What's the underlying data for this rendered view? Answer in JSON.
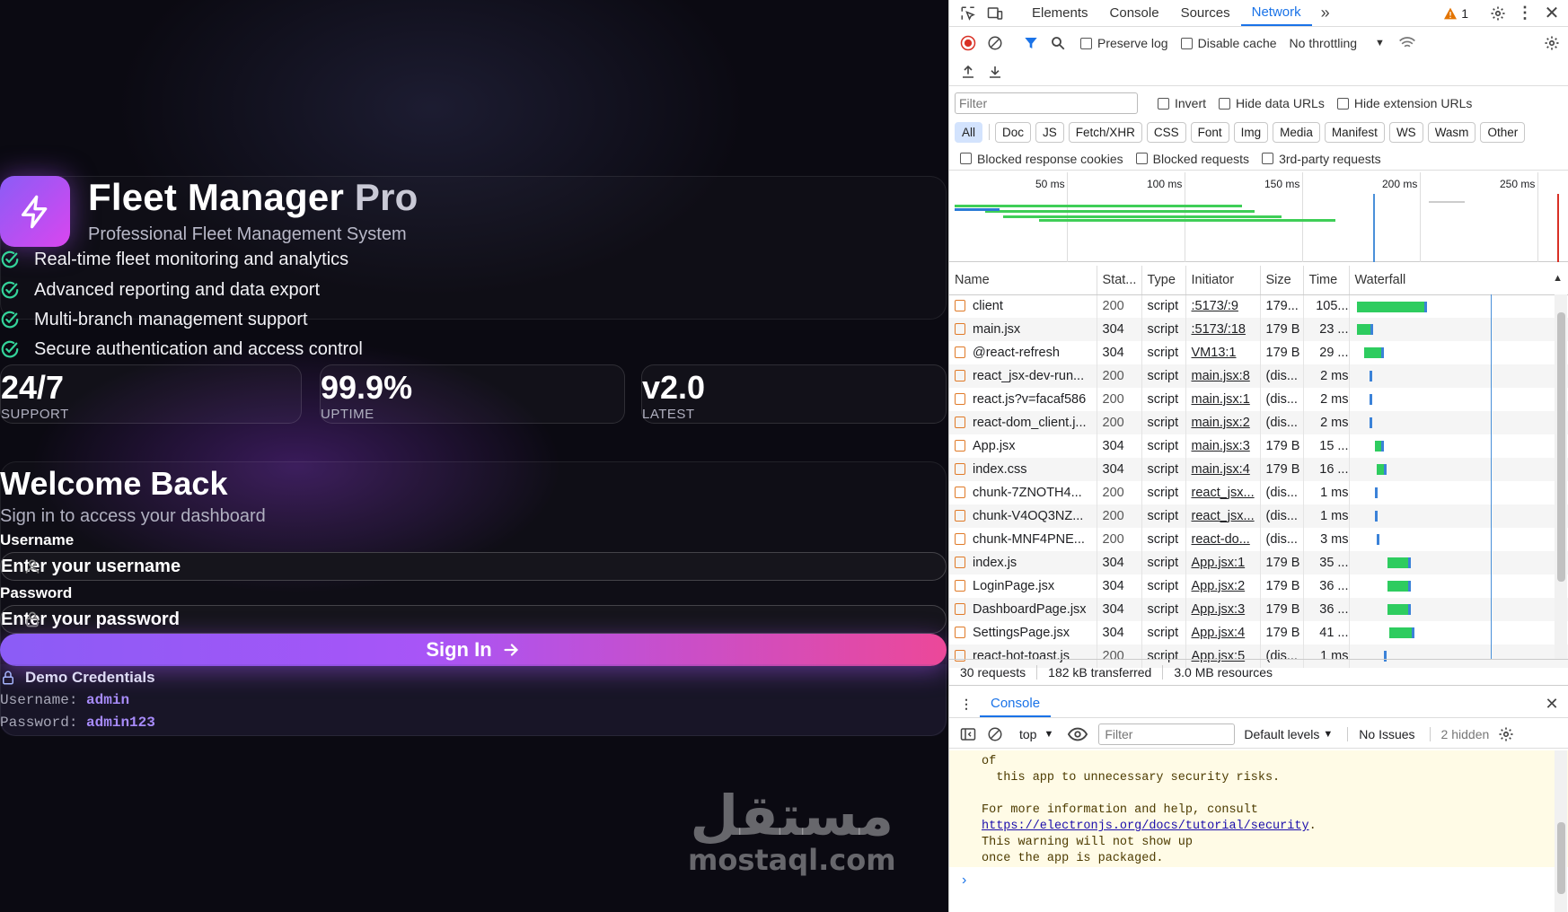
{
  "app": {
    "title": "Fleet Manager",
    "title_suffix": "Pro",
    "subtitle": "Professional Fleet Management System",
    "features": [
      "Real-time fleet monitoring and analytics",
      "Advanced reporting and data export",
      "Multi-branch management support",
      "Secure authentication and access control"
    ],
    "stats": [
      {
        "value": "24/7",
        "label": "SUPPORT"
      },
      {
        "value": "99.9%",
        "label": "UPTIME"
      },
      {
        "value": "v2.0",
        "label": "LATEST"
      }
    ],
    "login": {
      "title": "Welcome Back",
      "subtitle": "Sign in to access your dashboard",
      "username_label": "Username",
      "username_placeholder": "Enter your username",
      "password_label": "Password",
      "password_placeholder": "Enter your password",
      "submit_label": "Sign In"
    },
    "demo": {
      "title": "Demo Credentials",
      "username_key": "Username:",
      "username": "admin",
      "password_key": "Password:",
      "password": "admin123"
    },
    "watermark": {
      "arabic": "مستقل",
      "latin": "mostaql.com"
    },
    "accent": "#a855f7",
    "success": "#22c55e"
  },
  "devtools": {
    "tabs": [
      "Elements",
      "Console",
      "Sources",
      "Network"
    ],
    "active_tab": "Network",
    "warning_count": "1",
    "toolbar": {
      "preserve_log": "Preserve log",
      "disable_cache": "Disable cache",
      "throttling": "No throttling"
    },
    "filter": {
      "placeholder": "Filter",
      "invert": "Invert",
      "hide_data": "Hide data URLs",
      "hide_ext": "Hide extension URLs"
    },
    "chips": [
      "All",
      "Doc",
      "JS",
      "Fetch/XHR",
      "CSS",
      "Font",
      "Img",
      "Media",
      "Manifest",
      "WS",
      "Wasm",
      "Other"
    ],
    "blocked": {
      "cookies": "Blocked response cookies",
      "requests": "Blocked requests",
      "third": "3rd-party requests"
    },
    "timeline_ticks": [
      "50 ms",
      "100 ms",
      "150 ms",
      "200 ms",
      "250 ms"
    ],
    "columns": [
      "Name",
      "Stat...",
      "Type",
      "Initiator",
      "Size",
      "Time",
      "Waterfall"
    ],
    "requests": [
      {
        "name": "client",
        "status": "200",
        "type": "script",
        "initiator": ":5173/:9",
        "size": "179...",
        "time": "105..."
      },
      {
        "name": "main.jsx",
        "status": "304",
        "type": "script",
        "initiator": ":5173/:18",
        "size": "179 B",
        "time": "23 ..."
      },
      {
        "name": "@react-refresh",
        "status": "304",
        "type": "script",
        "initiator": "VM13:1",
        "size": "179 B",
        "time": "29 ..."
      },
      {
        "name": "react_jsx-dev-run...",
        "status": "200",
        "type": "script",
        "initiator": "main.jsx:8",
        "size": "(dis...",
        "time": "2 ms"
      },
      {
        "name": "react.js?v=facaf586",
        "status": "200",
        "type": "script",
        "initiator": "main.jsx:1",
        "size": "(dis...",
        "time": "2 ms"
      },
      {
        "name": "react-dom_client.j...",
        "status": "200",
        "type": "script",
        "initiator": "main.jsx:2",
        "size": "(dis...",
        "time": "2 ms"
      },
      {
        "name": "App.jsx",
        "status": "304",
        "type": "script",
        "initiator": "main.jsx:3",
        "size": "179 B",
        "time": "15 ..."
      },
      {
        "name": "index.css",
        "status": "304",
        "type": "script",
        "initiator": "main.jsx:4",
        "size": "179 B",
        "time": "16 ..."
      },
      {
        "name": "chunk-7ZNOTH4...",
        "status": "200",
        "type": "script",
        "initiator": "react_jsx...",
        "size": "(dis...",
        "time": "1 ms"
      },
      {
        "name": "chunk-V4OQ3NZ...",
        "status": "200",
        "type": "script",
        "initiator": "react_jsx...",
        "size": "(dis...",
        "time": "1 ms"
      },
      {
        "name": "chunk-MNF4PNE...",
        "status": "200",
        "type": "script",
        "initiator": "react-do...",
        "size": "(dis...",
        "time": "3 ms"
      },
      {
        "name": "index.js",
        "status": "304",
        "type": "script",
        "initiator": "App.jsx:1",
        "size": "179 B",
        "time": "35 ..."
      },
      {
        "name": "LoginPage.jsx",
        "status": "304",
        "type": "script",
        "initiator": "App.jsx:2",
        "size": "179 B",
        "time": "36 ..."
      },
      {
        "name": "DashboardPage.jsx",
        "status": "304",
        "type": "script",
        "initiator": "App.jsx:3",
        "size": "179 B",
        "time": "36 ..."
      },
      {
        "name": "SettingsPage.jsx",
        "status": "304",
        "type": "script",
        "initiator": "App.jsx:4",
        "size": "179 B",
        "time": "41 ..."
      },
      {
        "name": "react-hot-toast.js",
        "status": "200",
        "type": "script",
        "initiator": "App.jsx:5",
        "size": "(dis...",
        "time": "1 ms"
      }
    ],
    "summary": {
      "requests": "30 requests",
      "transferred": "182 kB transferred",
      "resources": "3.0 MB resources"
    },
    "console": {
      "tab": "Console",
      "context": "top",
      "filter_placeholder": "Filter",
      "levels": "Default levels",
      "issues": "No Issues",
      "hidden": "2 hidden",
      "lines": [
        "of",
        "  this app to unnecessary security risks.",
        "",
        "For more information and help, consult"
      ],
      "link": "https://electronjs.org/docs/tutorial/security",
      "link_suffix": ".",
      "lines2": [
        "This warning will not show up",
        "once the app is packaged."
      ]
    }
  }
}
